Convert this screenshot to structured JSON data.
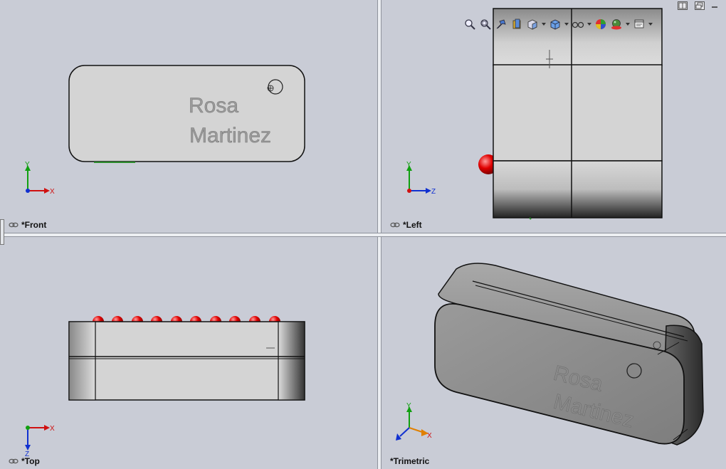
{
  "viewports": {
    "front": {
      "label": "*Front",
      "axis": {
        "y": "Y",
        "h": "X"
      }
    },
    "left": {
      "label": "*Left",
      "axis": {
        "y": "Y",
        "h": "Z"
      }
    },
    "top": {
      "label": "*Top",
      "axis": {
        "h": "X",
        "v": "Z"
      }
    },
    "trimetric": {
      "label": "*Trimetric",
      "axis": {
        "y": "Y",
        "x": "X"
      }
    }
  },
  "engraving": {
    "line1": "Rosa",
    "line2": "Martinez"
  },
  "toolbar": {
    "icons": [
      "zoom-to-fit-icon",
      "zoom-to-area-icon",
      "previous-view-icon",
      "section-view-icon",
      "view-orientation-icon",
      "display-style-icon",
      "hide-show-items-icon",
      "edit-appearance-icon",
      "apply-scene-icon",
      "view-settings-icon"
    ]
  },
  "window_controls": [
    "split-toggle-icon",
    "restore-icon",
    "minimize-icon"
  ],
  "colors": {
    "background": "#c9ccd6",
    "part": "#d2d2d2",
    "edge": "#1a1a1a",
    "pin": "#e00000",
    "axis_x": "#d01010",
    "axis_y": "#10a010",
    "axis_z": "#1030d0"
  }
}
